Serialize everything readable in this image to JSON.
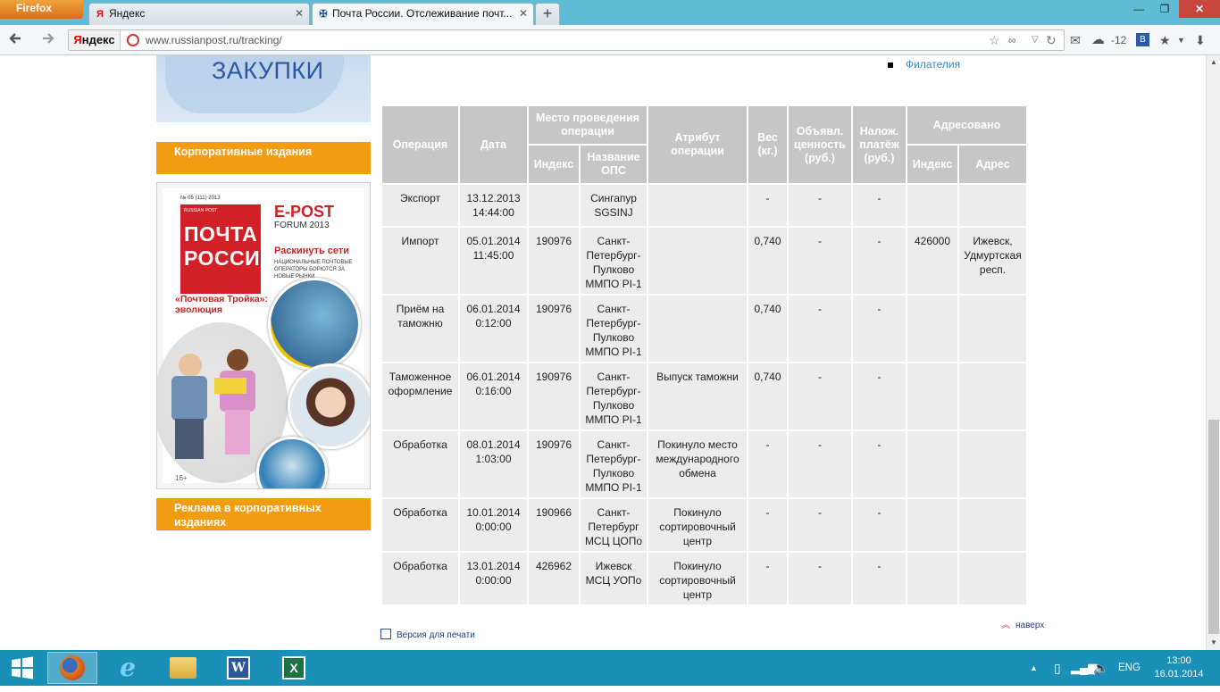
{
  "browser": {
    "menu_label": "Firefox",
    "tabs": [
      {
        "title": "Яндекс",
        "favicon": "Я",
        "active": false
      },
      {
        "title": "Почта России. Отслеживание почт...",
        "favicon": "eagle",
        "active": true
      }
    ],
    "new_tab": "+",
    "window_controls": {
      "minimize": "—",
      "maximize": "❐",
      "close": "✕"
    },
    "url": "www.russianpost.ru/tracking/",
    "yandex_logo_y": "Я",
    "yandex_logo_rest": "ндекс",
    "weather": "-12"
  },
  "sidebar": {
    "zakupki": "ЗАКУПКИ",
    "corporate_title": "Корпоративные издания",
    "ads_title": "Реклама в корпоративных изданиях",
    "magazine": {
      "issue": "№ 05 (111) 2013",
      "brand_small": "RUSSIAN POST",
      "brand": "ПОЧТА РОССИИ",
      "epost": "E-POST",
      "forum": "FORUM 2013",
      "headline": "Раскинуть сети",
      "subhead": "НАЦИОНАЛЬНЫЕ ПОЧТОВЫЕ ОПЕРАТОРЫ БОРЮТСЯ ЗА НОВЫЕ РЫНКИ",
      "troika": "«Почтовая Тройка»: эволюция",
      "age": "16+"
    }
  },
  "filatelia": "Филателия",
  "table": {
    "headers": {
      "operation": "Операция",
      "date": "Дата",
      "place": "Место проведения операции",
      "index": "Индекс",
      "ops_name": "Название ОПС",
      "attribute": "Атрибут операции",
      "weight": "Вес (кг.)",
      "declared": "Объявл. ценность (руб.)",
      "cod": "Налож. платёж (руб.)",
      "addressed": "Адресовано",
      "addr_index": "Индекс",
      "address": "Адрес"
    },
    "rows": [
      {
        "operation": "Экспорт",
        "date": "13.12.2013 14:44:00",
        "index": "",
        "ops": "Сингапур SGSINJ",
        "attribute": "",
        "weight": "-",
        "declared": "-",
        "cod": "-",
        "addr_index": "",
        "address": ""
      },
      {
        "operation": "Импорт",
        "date": "05.01.2014 11:45:00",
        "index": "190976",
        "ops": "Санкт-Петербург-Пулково ММПО PI-1",
        "attribute": "",
        "weight": "0,740",
        "declared": "-",
        "cod": "-",
        "addr_index": "426000",
        "address": "Ижевск, Удмуртская респ."
      },
      {
        "operation": "Приём на таможню",
        "date": "06.01.2014 0:12:00",
        "index": "190976",
        "ops": "Санкт-Петербург-Пулково ММПО PI-1",
        "attribute": "",
        "weight": "0,740",
        "declared": "-",
        "cod": "-",
        "addr_index": "",
        "address": ""
      },
      {
        "operation": "Таможенное оформление",
        "date": "06.01.2014 0:16:00",
        "index": "190976",
        "ops": "Санкт-Петербург-Пулково ММПО PI-1",
        "attribute": "Выпуск таможни",
        "weight": "0,740",
        "declared": "-",
        "cod": "-",
        "addr_index": "",
        "address": ""
      },
      {
        "operation": "Обработка",
        "date": "08.01.2014 1:03:00",
        "index": "190976",
        "ops": "Санкт-Петербург-Пулково ММПО PI-1",
        "attribute": "Покинуло место международного обмена",
        "weight": "-",
        "declared": "-",
        "cod": "-",
        "addr_index": "",
        "address": ""
      },
      {
        "operation": "Обработка",
        "date": "10.01.2014 0:00:00",
        "index": "190966",
        "ops": "Санкт-Петербург МСЦ ЦОПо",
        "attribute": "Покинуло сортировочный центр",
        "weight": "-",
        "declared": "-",
        "cod": "-",
        "addr_index": "",
        "address": ""
      },
      {
        "operation": "Обработка",
        "date": "13.01.2014 0:00:00",
        "index": "426962",
        "ops": "Ижевск МСЦ УОПо",
        "attribute": "Покинуло сортировочный центр",
        "weight": "-",
        "declared": "-",
        "cod": "-",
        "addr_index": "",
        "address": ""
      }
    ]
  },
  "naverh": "наверх",
  "print_version": "Версия для печати",
  "taskbar": {
    "lang": "ENG",
    "time": "13:00",
    "date": "16.01.2014"
  }
}
